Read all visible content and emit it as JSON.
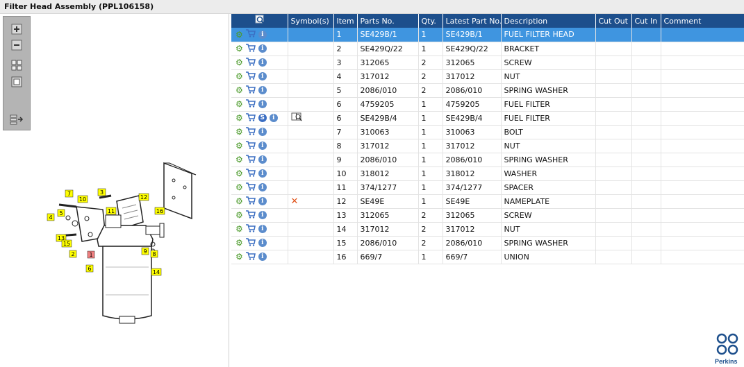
{
  "window": {
    "title": "Filter Head Assembly (PPL106158)"
  },
  "toolbar": {
    "buttons": [
      "zoom-in-icon",
      "zoom-out-icon",
      "fit-all-icon",
      "fit-window-icon",
      "export-list-icon"
    ]
  },
  "table": {
    "columns": [
      "",
      "Symbol(s)",
      "Item",
      "Parts No.",
      "Qty.",
      "Latest Part No.",
      "Description",
      "Cut Out",
      "Cut In",
      "Comment"
    ],
    "rows": [
      {
        "item": "1",
        "part": "SE429B/1",
        "qty": "1",
        "latest": "SE429B/1",
        "desc": "FUEL FILTER HEAD",
        "selected": true
      },
      {
        "item": "2",
        "part": "SE429Q/22",
        "qty": "1",
        "latest": "SE429Q/22",
        "desc": "BRACKET"
      },
      {
        "item": "3",
        "part": "312065",
        "qty": "2",
        "latest": "312065",
        "desc": "SCREW"
      },
      {
        "item": "4",
        "part": "317012",
        "qty": "2",
        "latest": "317012",
        "desc": "NUT"
      },
      {
        "item": "5",
        "part": "2086/010",
        "qty": "2",
        "latest": "2086/010",
        "desc": "SPRING WASHER"
      },
      {
        "item": "6",
        "part": "4759205",
        "qty": "1",
        "latest": "4759205",
        "desc": "FUEL FILTER"
      },
      {
        "item": "6",
        "part": "SE429B/4",
        "qty": "1",
        "latest": "SE429B/4",
        "desc": "FUEL FILTER",
        "service": true,
        "symbol": "book"
      },
      {
        "item": "7",
        "part": "310063",
        "qty": "1",
        "latest": "310063",
        "desc": "BOLT"
      },
      {
        "item": "8",
        "part": "317012",
        "qty": "1",
        "latest": "317012",
        "desc": "NUT"
      },
      {
        "item": "9",
        "part": "2086/010",
        "qty": "1",
        "latest": "2086/010",
        "desc": "SPRING WASHER"
      },
      {
        "item": "10",
        "part": "318012",
        "qty": "1",
        "latest": "318012",
        "desc": "WASHER"
      },
      {
        "item": "11",
        "part": "374/1277",
        "qty": "1",
        "latest": "374/1277",
        "desc": "SPACER"
      },
      {
        "item": "12",
        "part": "SE49E",
        "qty": "1",
        "latest": "SE49E",
        "desc": "NAMEPLATE",
        "symbol": "x"
      },
      {
        "item": "13",
        "part": "312065",
        "qty": "2",
        "latest": "312065",
        "desc": "SCREW"
      },
      {
        "item": "14",
        "part": "317012",
        "qty": "2",
        "latest": "317012",
        "desc": "NUT"
      },
      {
        "item": "15",
        "part": "2086/010",
        "qty": "2",
        "latest": "2086/010",
        "desc": "SPRING WASHER"
      },
      {
        "item": "16",
        "part": "669/7",
        "qty": "1",
        "latest": "669/7",
        "desc": "UNION"
      }
    ]
  },
  "drawing": {
    "callouts": [
      "7",
      "3",
      "10",
      "12",
      "4",
      "5",
      "11",
      "16",
      "13",
      "15",
      "2",
      "1",
      "9",
      "8",
      "6",
      "14"
    ]
  },
  "brand": {
    "name": "Perkins"
  },
  "colors": {
    "header": "#1d4f8c",
    "selected_row": "#3f95e0",
    "callout": "#ffff00",
    "highlight_callout": "#f08080"
  }
}
